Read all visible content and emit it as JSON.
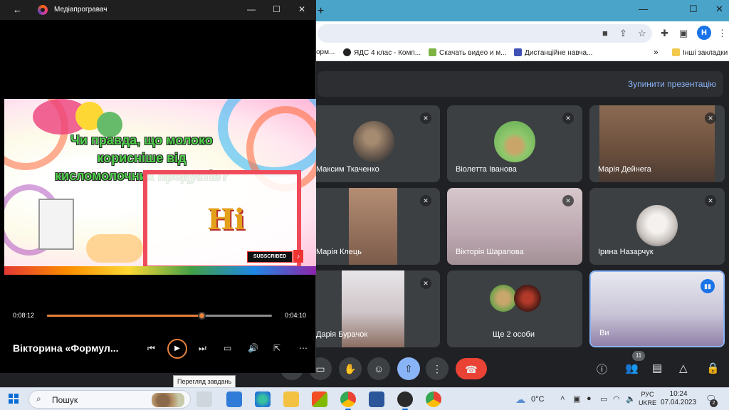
{
  "player": {
    "title": "Медіапрогравач",
    "video_text": "Чи правда, що молоко корисніше від кисломолочних продуктів?",
    "hi_text": "Hi",
    "subscribed": "SUBSCRIBED",
    "time_current": "0:08:12",
    "time_total": "0:04:10",
    "progress": 0.69,
    "now_playing": "Вікторина «Формул...",
    "tooltip": "Перегляд завдань"
  },
  "chrome": {
    "bookmarks": [
      {
        "label": "орм...",
        "color": "#4285f4"
      },
      {
        "label": "ЯДС 4 клас - Комп...",
        "color": "#222222"
      },
      {
        "label": "Скачать видео и м...",
        "color": "#7cb342"
      },
      {
        "label": "Дистанційне навча...",
        "color": "#3f51b5"
      }
    ],
    "bookmarks_more": "»",
    "other_bookmarks": "Інші закладки",
    "profile_initial": "Н"
  },
  "meet": {
    "stop_presenting": "Зупинити презентацію",
    "participants": [
      {
        "name": "Максим Ткаченко"
      },
      {
        "name": "Віолетта Іванова"
      },
      {
        "name": "Марія Дейнега"
      },
      {
        "name": "Марія Клець"
      },
      {
        "name": "Вікторія Шарапова"
      },
      {
        "name": "Ірина Назарчук"
      },
      {
        "name": "Дарія Бурачок"
      },
      {
        "name": "Ще 2 особи"
      },
      {
        "name": "Ви"
      }
    ],
    "people_count": "11"
  },
  "taskbar": {
    "search_label": "Пошук",
    "temperature": "0°C",
    "lang_line1": "РУС",
    "lang_line2": "UKRE",
    "time": "10:24",
    "date": "07.04.2023",
    "notifications": "2"
  }
}
